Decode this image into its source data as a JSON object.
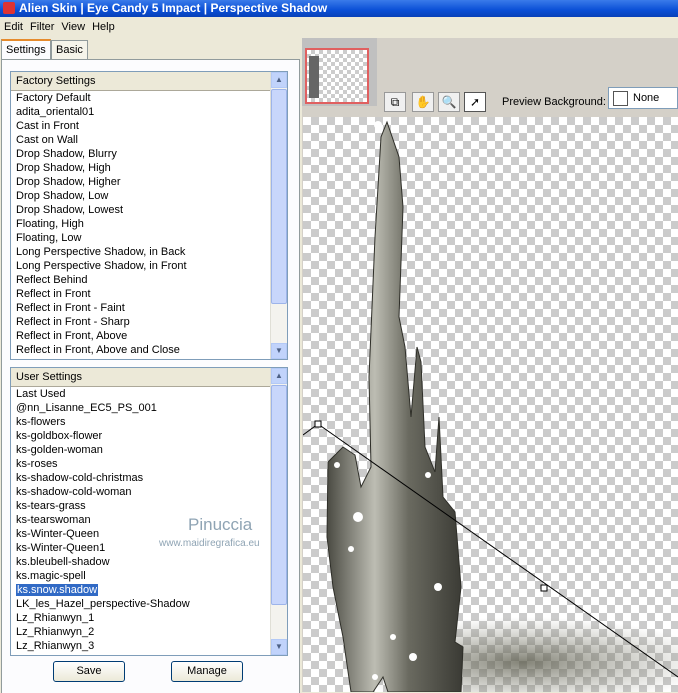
{
  "window": {
    "title": "Alien Skin  |  Eye Candy 5 Impact  |  Perspective Shadow"
  },
  "menu": [
    "Edit",
    "Filter",
    "View",
    "Help"
  ],
  "tabs": [
    "Settings",
    "Basic"
  ],
  "factory": {
    "header": "Factory Settings",
    "items": [
      "Factory Default",
      "adita_oriental01",
      "Cast in Front",
      "Cast on Wall",
      "Drop Shadow, Blurry",
      "Drop Shadow, High",
      "Drop Shadow, Higher",
      "Drop Shadow, Low",
      "Drop Shadow, Lowest",
      "Floating, High",
      "Floating, Low",
      "Long Perspective Shadow, in Back",
      "Long Perspective Shadow, in Front",
      "Reflect Behind",
      "Reflect in Front",
      "Reflect in Front - Faint",
      "Reflect in Front - Sharp",
      "Reflect in Front, Above",
      "Reflect in Front, Above and Close"
    ]
  },
  "user": {
    "header": "User Settings",
    "items": [
      "Last Used",
      "@nn_Lisanne_EC5_PS_001",
      "ks-flowers",
      "ks-goldbox-flower",
      "ks-golden-woman",
      "ks-roses",
      "ks-shadow-cold-christmas",
      "ks-shadow-cold-woman",
      "ks-tears-grass",
      "ks-tearswoman",
      "ks-Winter-Queen",
      "ks-Winter-Queen1",
      "ks.bleubell-shadow",
      "ks.magic-spell",
      "ks.snow.shadow",
      "LK_les_Hazel_perspective-Shadow",
      "Lz_Rhianwyn_1",
      "Lz_Rhianwyn_2",
      "Lz_Rhianwyn_3"
    ],
    "selected_index": 14
  },
  "buttons": {
    "save": "Save",
    "manage": "Manage"
  },
  "watermark": {
    "name": "Pinuccia",
    "site": "www.maidiregrafica.eu"
  },
  "preview": {
    "background_label": "Preview Background:",
    "background_value": "None",
    "active_tool": "arrow"
  },
  "colors": {
    "title_bar": "#0a4fd6",
    "selection": "#316ac5",
    "thumbnail_border": "#e06060"
  }
}
